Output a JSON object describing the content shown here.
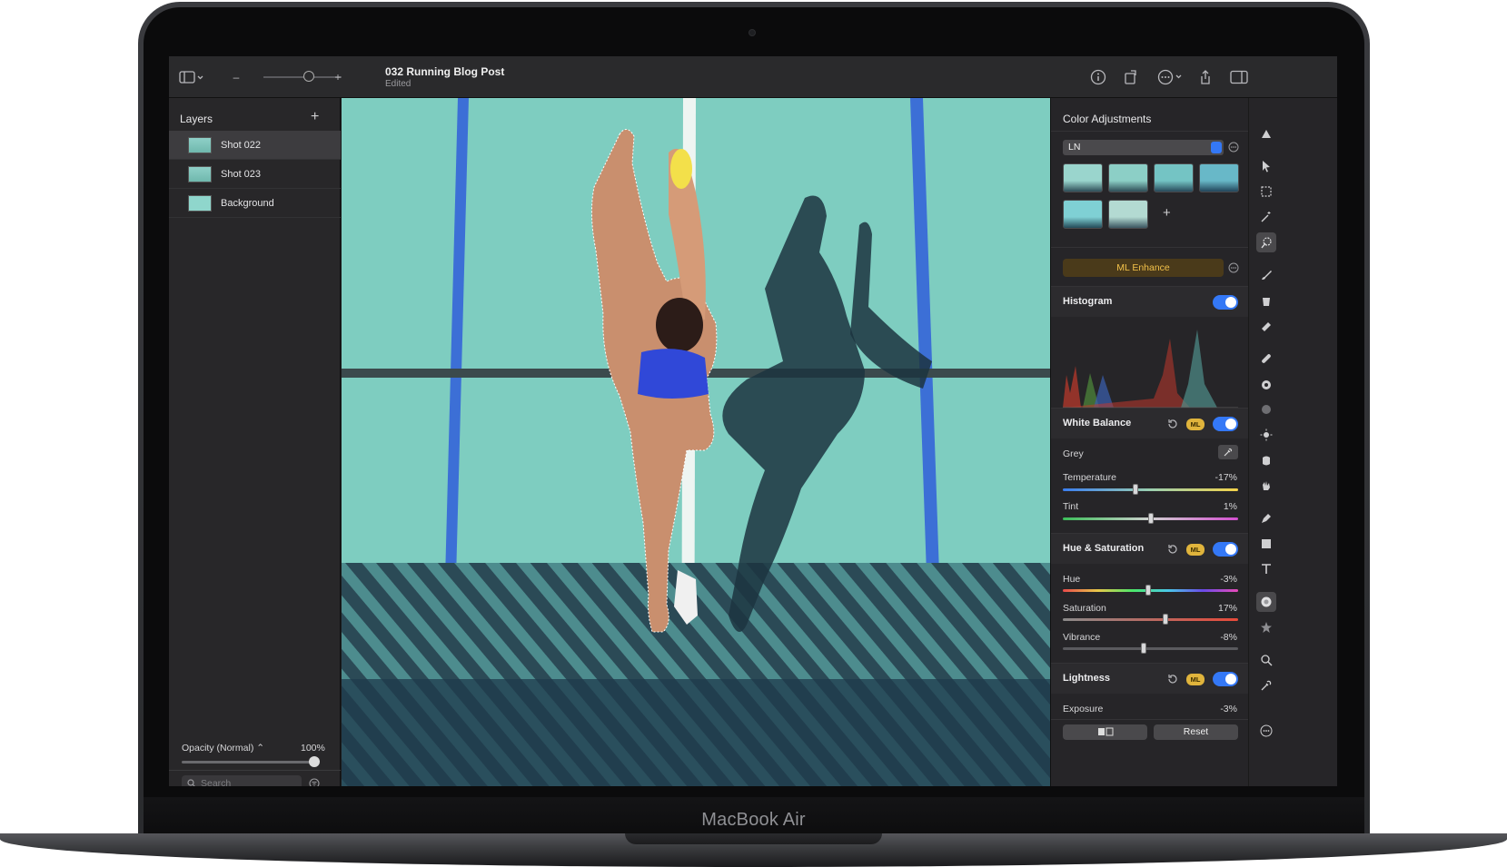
{
  "device": {
    "brand": "MacBook Air"
  },
  "document": {
    "title": "032 Running Blog Post",
    "subtitle": "Edited"
  },
  "toolbar": {
    "zoom_minus": "–",
    "zoom_plus": "+"
  },
  "layers": {
    "title": "Layers",
    "add_label": "+",
    "items": [
      {
        "label": "Shot 022",
        "selected": true
      },
      {
        "label": "Shot 023",
        "selected": false
      },
      {
        "label": "Background",
        "selected": false
      }
    ],
    "opacity_label": "Opacity (Normal) ⌃",
    "opacity_value": "100%",
    "opacity_fraction": 1.0,
    "search_placeholder": "Search"
  },
  "adjustments": {
    "title": "Color Adjustments",
    "preset_value": "LN",
    "add_preset": "+",
    "ml_enhance_label": "ML Enhance",
    "histogram_label": "Histogram",
    "ml_badge": "ML",
    "white_balance": {
      "label": "White Balance",
      "grey_label": "Grey",
      "temperature_label": "Temperature",
      "temperature_value": "-17%",
      "temperature_level": -0.17,
      "tint_label": "Tint",
      "tint_value": "1%",
      "tint_level": 0.01
    },
    "hue_saturation": {
      "label": "Hue & Saturation",
      "hue_label": "Hue",
      "hue_value": "-3%",
      "hue_level": -0.03,
      "saturation_label": "Saturation",
      "saturation_value": "17%",
      "saturation_level": 0.17,
      "vibrance_label": "Vibrance",
      "vibrance_value": "-8%",
      "vibrance_level": -0.08
    },
    "lightness": {
      "label": "Lightness",
      "exposure_label": "Exposure",
      "exposure_value": "-3%"
    },
    "reset_label": "Reset"
  },
  "colors": {
    "accent": "#3478f6",
    "ml_badge": "#e0b43c",
    "track_court": "#7ecdc0",
    "lane_blue": "#3c6fd6"
  },
  "tool_icons": [
    "brush-style-icon",
    "arrow-select-icon",
    "marquee-select-icon",
    "magic-wand-icon",
    "quick-select-icon",
    "paint-brush-icon",
    "paint-bucket-icon",
    "eraser-icon",
    "bandage-icon",
    "clone-icon",
    "blur-icon",
    "light-icon",
    "sponge-icon",
    "smudge-icon",
    "pen-icon",
    "shape-icon",
    "text-icon",
    "color-adjust-icon",
    "effects-icon",
    "zoom-icon",
    "eyedropper-icon",
    "more-icon"
  ]
}
